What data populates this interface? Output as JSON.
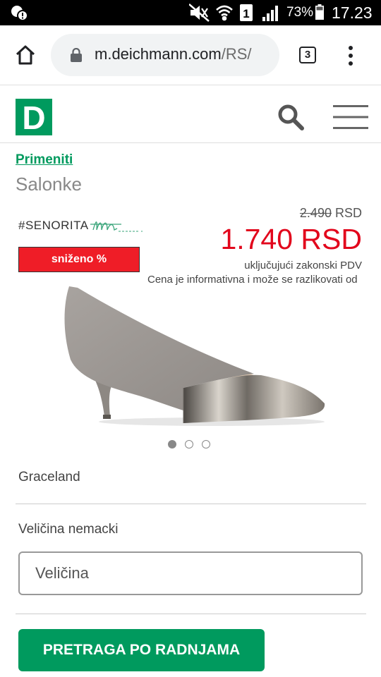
{
  "status_bar": {
    "battery_percent": "73%",
    "time": "17.23",
    "sim_slot": "1",
    "icons": [
      "notification-icon",
      "mute-icon",
      "wifi-icon",
      "sim1-icon",
      "signal-icon",
      "battery-icon"
    ]
  },
  "browser": {
    "url_host": "m.deichmann.com",
    "url_rest": "/RS/",
    "tab_count": "3",
    "icons": [
      "home-icon",
      "lock-icon",
      "tabs-icon",
      "overflow-menu-icon"
    ]
  },
  "site_header": {
    "logo_letter": "D",
    "brand_color": "#009a5e",
    "icons": [
      "search-icon",
      "hamburger-menu-icon"
    ]
  },
  "breadcrumb": "Primeniti",
  "category": "Salonke",
  "product": {
    "brand_tag": "#SENORITA",
    "sale_badge": "sniženo %",
    "old_price_value": "2.490",
    "old_price_currency": "RSD",
    "new_price": "1.740 RSD",
    "vat_note": "uključujući zakonski PDV",
    "info_note": "Cena je informativna i može se razlikovati od",
    "brand_name": "Graceland",
    "accent_color": "#e2061c",
    "badge_color": "#ef1d27"
  },
  "gallery": {
    "image_count": 3,
    "active_index": 0
  },
  "size": {
    "label": "Veličina nemacki",
    "placeholder": "Veličina"
  },
  "store_button": "PRETRAGA PO RADNJAMA"
}
